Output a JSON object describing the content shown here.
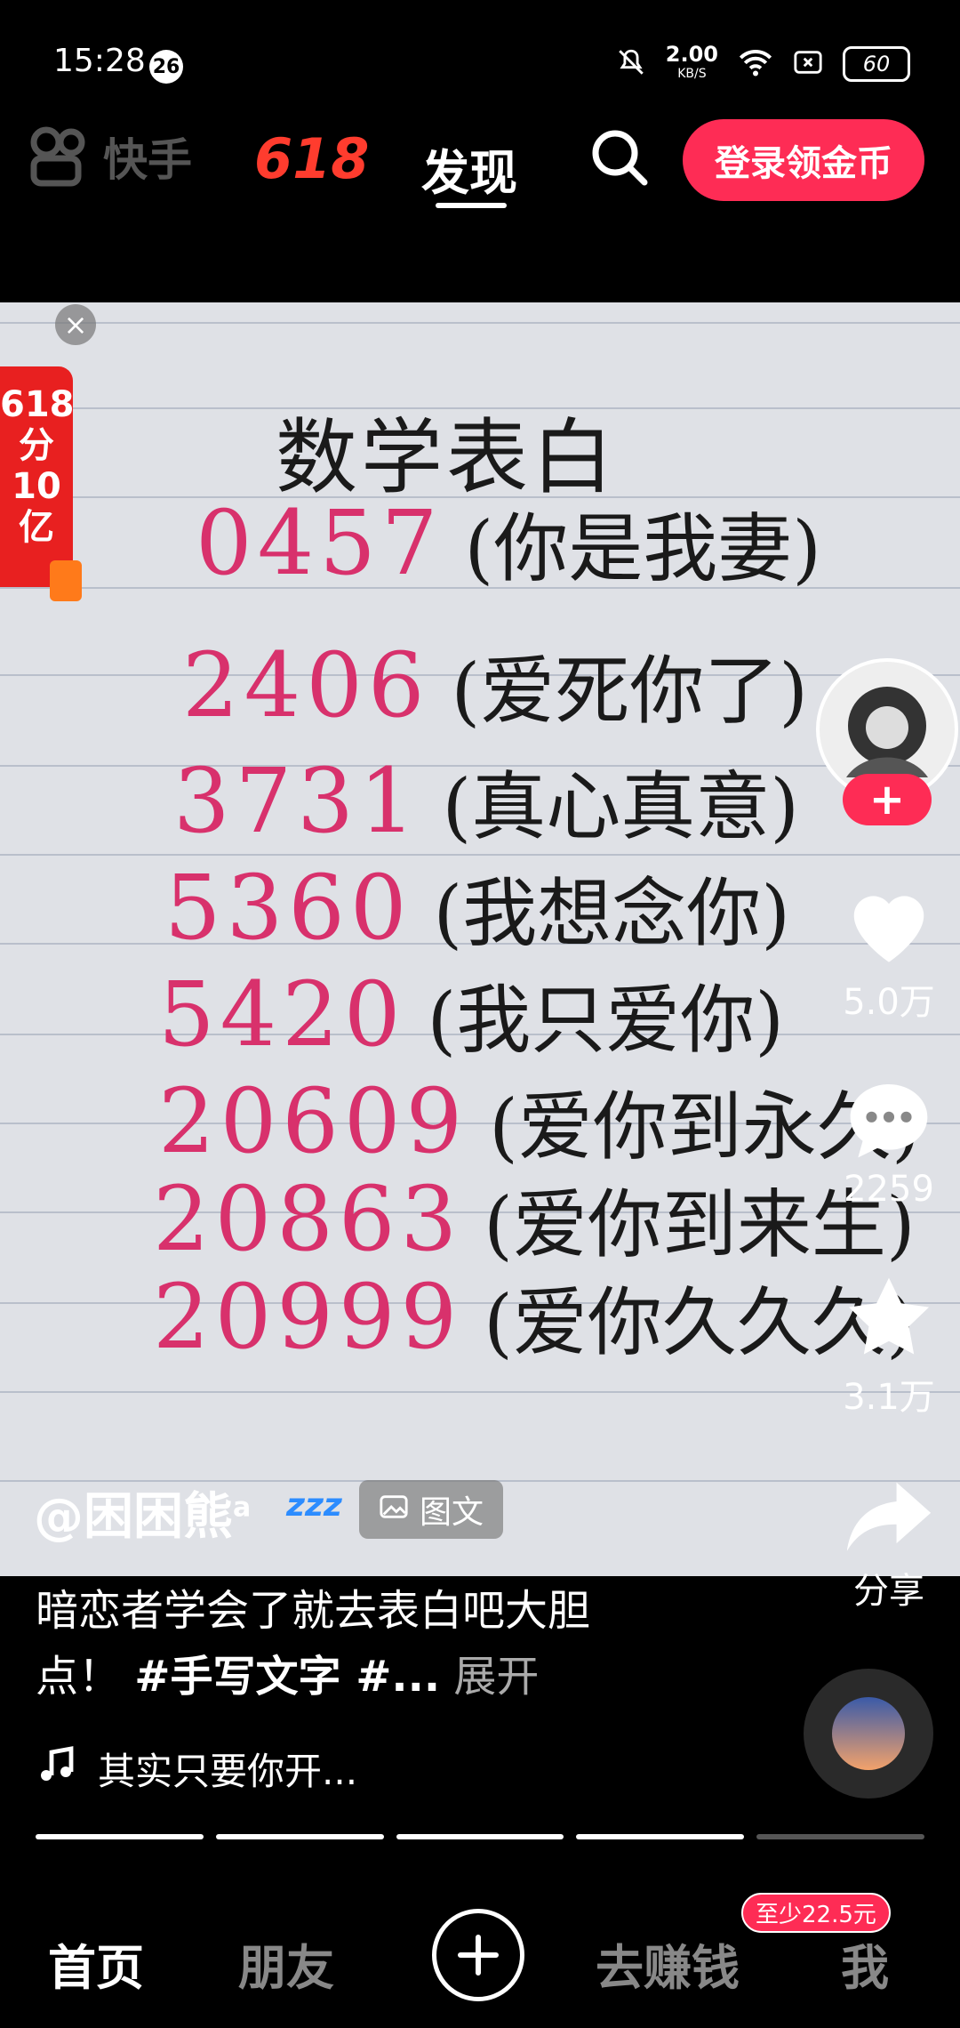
{
  "status_bar": {
    "time": "15:28",
    "notification_count": "26",
    "net_speed": "2.00",
    "net_unit": "KB/S",
    "battery": "60",
    "icons": [
      "bell-off-icon",
      "wifi-icon",
      "sim-off-icon",
      "battery-icon"
    ]
  },
  "top_nav": {
    "app_name": "快手",
    "event_badge": "618",
    "title": "发现",
    "login_button": "登录领金币"
  },
  "promo": {
    "line1": "618",
    "line2": "分",
    "line3": "10",
    "line4": "亿"
  },
  "note": {
    "title": "数学表白",
    "rows": [
      {
        "num": "0457",
        "meaning": "(你是我妻)"
      },
      {
        "num": "2406",
        "meaning": "(爱死你了)"
      },
      {
        "num": "3731",
        "meaning": "(真心真意)"
      },
      {
        "num": "5360",
        "meaning": "(我想念你)"
      },
      {
        "num": "5420",
        "meaning": "(我只爱你)"
      },
      {
        "num": "20609",
        "meaning": "(爱你到永久)"
      },
      {
        "num": "20863",
        "meaning": "(爱你到来生)"
      },
      {
        "num": "20999",
        "meaning": "(爱你久久久)"
      }
    ]
  },
  "author": {
    "handle": "@困困熊",
    "superscript": "a",
    "zzz": "zzz",
    "tag": "图文"
  },
  "rail": {
    "likes": "5.0万",
    "comments": "2259",
    "favorites": "3.1万",
    "share": "分享"
  },
  "caption": {
    "text": "暗恋者学会了就去表白吧大胆点！",
    "tags": "#手写文字 #...",
    "expand": "展开"
  },
  "music": {
    "title": "其实只要你开..."
  },
  "bottom_nav": {
    "home": "首页",
    "friends": "朋友",
    "earn": "去赚钱",
    "me": "我",
    "reward": "至少22.5元"
  },
  "colors": {
    "accent": "#fe2c55",
    "number_ink": "#d8316c",
    "promo_red": "#e82020"
  }
}
